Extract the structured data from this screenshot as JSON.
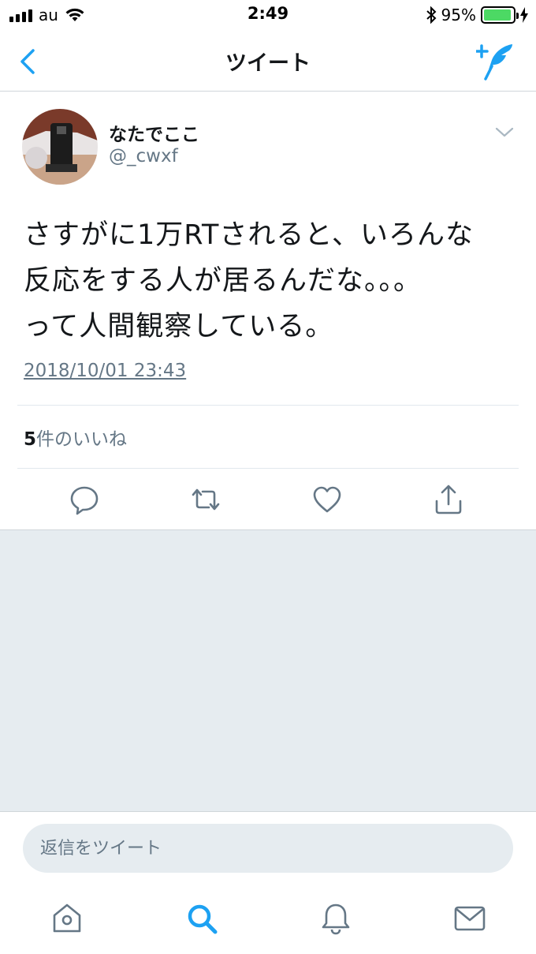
{
  "status_bar": {
    "carrier": "au",
    "time": "2:49",
    "battery_percent": "95%",
    "battery_level": 0.95,
    "battery_color": "#4cd964"
  },
  "nav": {
    "title": "ツイート",
    "back_icon": "chevron-left-icon",
    "compose_icon": "compose-tweet-icon"
  },
  "tweet": {
    "display_name": "なたでここ",
    "handle": "@_cwxf",
    "text": "さすがに1万RTされると、いろんな\n反応をする人が居るんだな。。。\nって人間観察している。",
    "timestamp": "2018/10/01 23:43",
    "likes_count": "5",
    "likes_label": "件のいいね"
  },
  "actions": [
    "reply-icon",
    "retweet-icon",
    "like-icon",
    "share-icon"
  ],
  "reply": {
    "placeholder": "返信をツイート"
  },
  "tabs": [
    "home-icon",
    "search-icon",
    "notifications-icon",
    "messages-icon"
  ],
  "colors": {
    "accent": "#1da1f2",
    "icon_gray": "#657786",
    "background_gray": "#e6ecf0"
  }
}
